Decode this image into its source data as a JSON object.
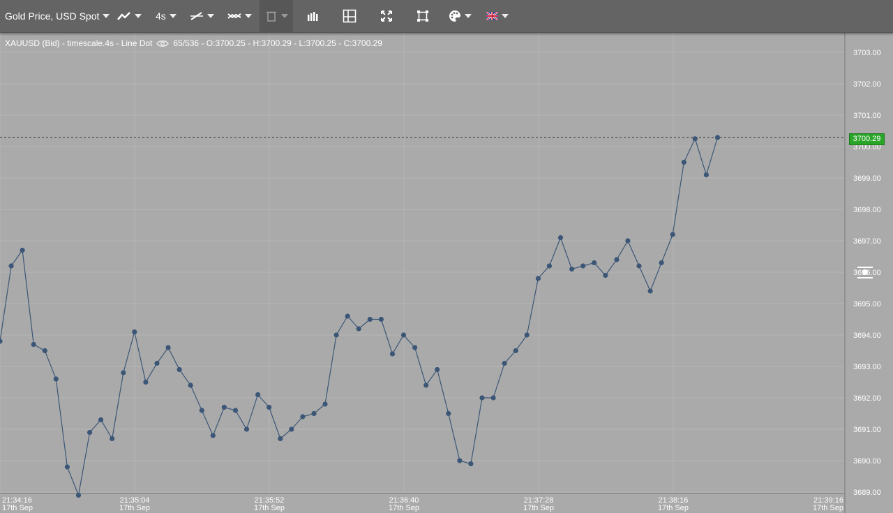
{
  "toolbar": {
    "instrument": "Gold Price, USD Spot",
    "timeframe": "4s"
  },
  "info": {
    "symbol": "XAUUSD (Bid) - timescale.4s - Line Dot",
    "stats": "65/536 - O:3700.25 - H:3700.29 - L:3700.25 - C:3700.29"
  },
  "current_price": "3700.29",
  "colors": {
    "background": "#aaaaaa",
    "toolbar": "#646464",
    "line": "#3b5676",
    "price_tag": "#2aa52a"
  },
  "icons": [
    "line-chart-icon",
    "line-style-icon",
    "compare-icon",
    "trash-icon",
    "bar-chart-icon",
    "layout-icon",
    "fullscreen-icon",
    "crop-icon",
    "palette-icon",
    "uk-flag-icon"
  ],
  "chart_data": {
    "type": "line",
    "marker": "dot",
    "ylim": [
      3689,
      3703.5
    ],
    "grid": true,
    "y_ticks": [
      "3703.00",
      "3702.00",
      "3701.00",
      "3700.00",
      "3699.00",
      "3698.00",
      "3697.00",
      "3696.00",
      "3695.00",
      "3694.00",
      "3693.00",
      "3692.00",
      "3691.00",
      "3690.00",
      "3689.00"
    ],
    "x_ticks": [
      {
        "time": "21:34:16",
        "date": "17th Sep"
      },
      {
        "time": "21:35:04",
        "date": "17th Sep"
      },
      {
        "time": "21:35:52",
        "date": "17th Sep"
      },
      {
        "time": "21:36:40",
        "date": "17th Sep"
      },
      {
        "time": "21:37:28",
        "date": "17th Sep"
      },
      {
        "time": "21:38:16",
        "date": "17th Sep"
      },
      {
        "time": "21:39:16",
        "date": "17th Sep"
      }
    ],
    "x_start": "21:34:16",
    "x_step_seconds": 4,
    "values": [
      3693.8,
      3696.2,
      3696.7,
      3693.7,
      3693.5,
      3692.6,
      3689.8,
      3688.9,
      3690.9,
      3691.3,
      3690.7,
      3692.8,
      3694.1,
      3692.5,
      3693.1,
      3693.6,
      3692.9,
      3692.4,
      3691.6,
      3690.8,
      3691.7,
      3691.6,
      3691.0,
      3692.1,
      3691.7,
      3690.7,
      3691.0,
      3691.4,
      3691.5,
      3691.8,
      3694.0,
      3694.6,
      3694.2,
      3694.5,
      3694.5,
      3693.4,
      3694.0,
      3693.6,
      3692.4,
      3692.9,
      3691.5,
      3690.0,
      3689.9,
      3692.0,
      3692.0,
      3693.1,
      3693.5,
      3694.0,
      3695.8,
      3696.2,
      3697.1,
      3696.1,
      3696.2,
      3696.3,
      3695.9,
      3696.4,
      3697.0,
      3696.2,
      3695.4,
      3696.3,
      3697.2,
      3699.5,
      3700.25,
      3699.1,
      3700.29
    ],
    "last_value": 3700.29
  }
}
